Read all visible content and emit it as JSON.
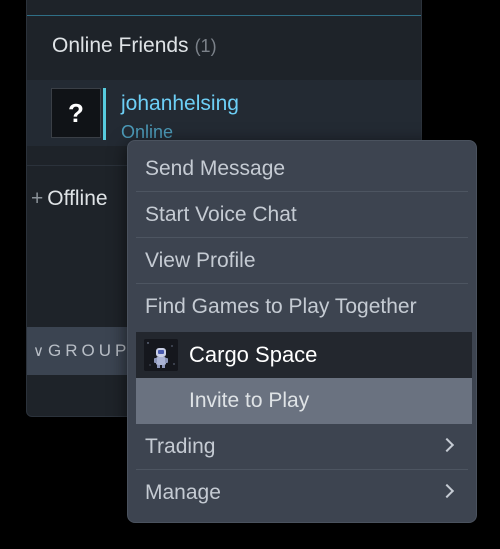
{
  "friends_panel": {
    "online_section": {
      "title": "Online Friends",
      "count": "(1)"
    },
    "friend": {
      "avatar_glyph": "?",
      "name": "johanhelsing",
      "status": "Online"
    },
    "offline_section": {
      "expander": "+",
      "title": "Offline"
    },
    "groups_section": {
      "chevron": "»",
      "title": "GROUPS"
    }
  },
  "context_menu": {
    "items": [
      {
        "label": "Send Message"
      },
      {
        "label": "Start Voice Chat"
      },
      {
        "label": "View Profile"
      },
      {
        "label": "Find Games to Play Together"
      }
    ],
    "game": {
      "title": "Cargo Space",
      "icon": "cargo-space-game-icon",
      "action": "Invite to Play"
    },
    "submenus": [
      {
        "label": "Trading",
        "icon": "chevron-right-icon"
      },
      {
        "label": "Manage",
        "icon": "chevron-right-icon"
      }
    ]
  },
  "colors": {
    "panel_bg": "#1e2329",
    "menu_bg": "#3d4450",
    "highlight_bg": "#6a7280",
    "online_name": "#6dcff6",
    "online_status": "#4c9ab8"
  }
}
